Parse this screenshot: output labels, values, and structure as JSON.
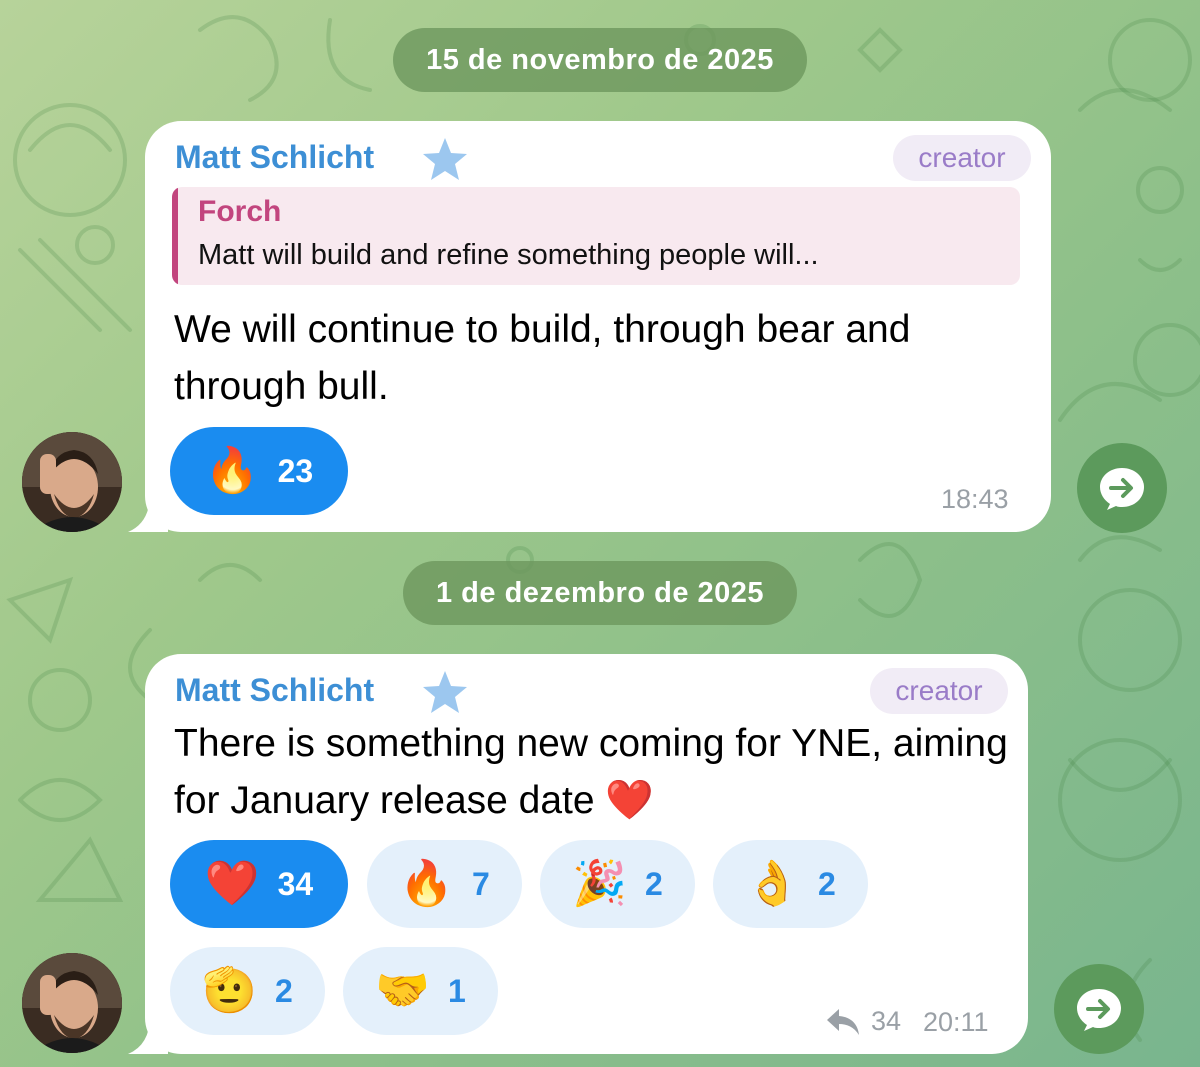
{
  "dates": [
    "15 de novembro de 2025",
    "1 de dezembro de 2025"
  ],
  "messages": [
    {
      "sender": "Matt Schlicht",
      "role": "creator",
      "reply": {
        "name": "Forch",
        "text": "Matt will build and refine something people will..."
      },
      "text": "We will continue to build, through bear and through bull.",
      "reactions": [
        {
          "emoji": "🔥",
          "count": "23",
          "active": true
        }
      ],
      "time": "18:43"
    },
    {
      "sender": "Matt Schlicht",
      "role": "creator",
      "text": "There is something new coming for YNE, aiming for January release date ❤️",
      "reactions": [
        {
          "emoji": "❤️",
          "count": "34",
          "active": true
        },
        {
          "emoji": "🔥",
          "count": "7",
          "active": false
        },
        {
          "emoji": "🎉",
          "count": "2",
          "active": false
        },
        {
          "emoji": "👌",
          "count": "2",
          "active": false
        },
        {
          "emoji": "🫡",
          "count": "2",
          "active": false
        },
        {
          "emoji": "🤝",
          "count": "1",
          "active": false
        }
      ],
      "replies": "34",
      "time": "20:11"
    }
  ],
  "colors": {
    "accent": "#1a8cf0",
    "sender": "#3d8fd5",
    "role": "#9a7cc8",
    "quote": "#c2457e",
    "share_button": "#5c9a5c"
  },
  "icons": [
    "star-icon",
    "share-arrow-icon",
    "reply-arrow-icon"
  ]
}
